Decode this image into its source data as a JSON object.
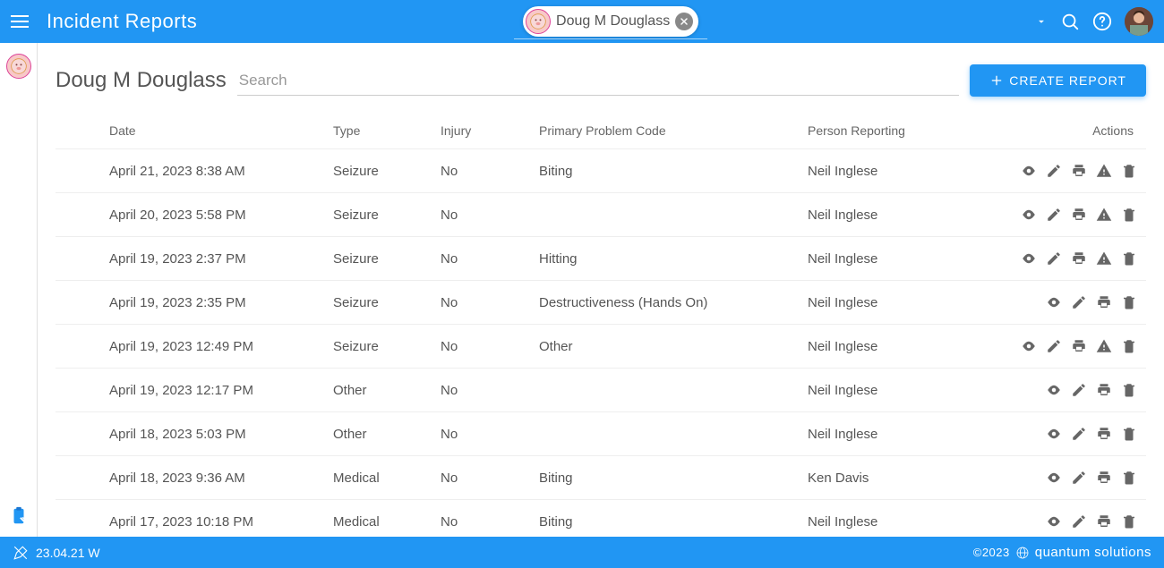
{
  "header": {
    "title": "Incident Reports",
    "chip_name": "Doug M Douglass"
  },
  "main": {
    "person_name": "Doug M Douglass",
    "search_placeholder": "Search",
    "create_label": "CREATE REPORT"
  },
  "columns": {
    "date": "Date",
    "type": "Type",
    "injury": "Injury",
    "problem": "Primary Problem Code",
    "reporter": "Person Reporting",
    "actions": "Actions"
  },
  "rows": [
    {
      "date": "April 21, 2023 8:38 AM",
      "type": "Seizure",
      "injury": "No",
      "problem": "Biting",
      "reporter": "Neil Inglese",
      "warn": true
    },
    {
      "date": "April 20, 2023 5:58 PM",
      "type": "Seizure",
      "injury": "No",
      "problem": "",
      "reporter": "Neil Inglese",
      "warn": true
    },
    {
      "date": "April 19, 2023 2:37 PM",
      "type": "Seizure",
      "injury": "No",
      "problem": "Hitting",
      "reporter": "Neil Inglese",
      "warn": true
    },
    {
      "date": "April 19, 2023 2:35 PM",
      "type": "Seizure",
      "injury": "No",
      "problem": "Destructiveness (Hands On)",
      "reporter": "Neil Inglese",
      "warn": false
    },
    {
      "date": "April 19, 2023 12:49 PM",
      "type": "Seizure",
      "injury": "No",
      "problem": "Other",
      "reporter": "Neil Inglese",
      "warn": true
    },
    {
      "date": "April 19, 2023 12:17 PM",
      "type": "Other",
      "injury": "No",
      "problem": "",
      "reporter": "Neil Inglese",
      "warn": false
    },
    {
      "date": "April 18, 2023 5:03 PM",
      "type": "Other",
      "injury": "No",
      "problem": "",
      "reporter": "Neil Inglese",
      "warn": false
    },
    {
      "date": "April 18, 2023 9:36 AM",
      "type": "Medical",
      "injury": "No",
      "problem": "Biting",
      "reporter": "Ken Davis",
      "warn": false
    },
    {
      "date": "April 17, 2023 10:18 PM",
      "type": "Medical",
      "injury": "No",
      "problem": "Biting",
      "reporter": "Neil Inglese",
      "warn": false
    }
  ],
  "footer": {
    "version": "23.04.21 W",
    "copyright": "©2023",
    "brand": "quantum solutions"
  }
}
